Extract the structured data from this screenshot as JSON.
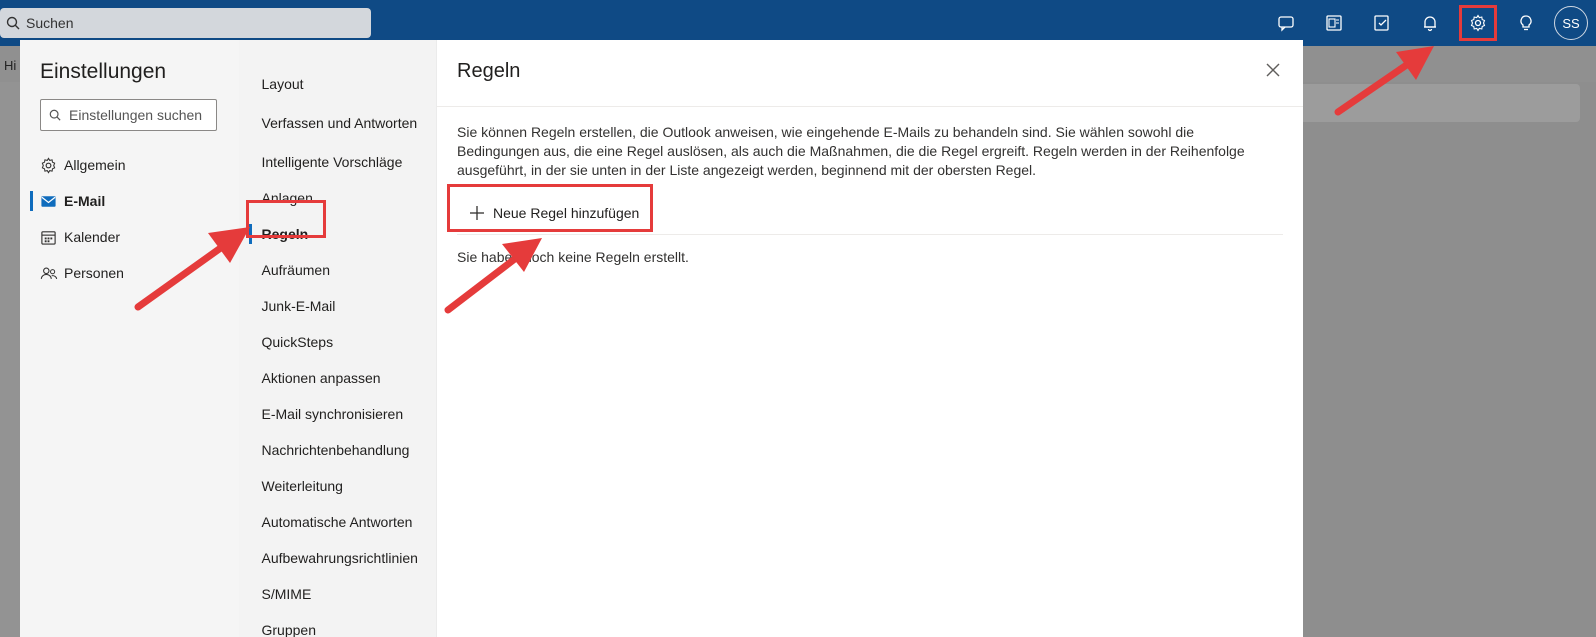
{
  "topbar": {
    "search_placeholder": "Suchen",
    "avatar_initials": "SS",
    "icons": [
      "teams-chat-icon",
      "outlook-notes-icon",
      "todo-icon",
      "bell-icon",
      "gear-icon",
      "lightbulb-icon"
    ],
    "background_color": "#0f4a85"
  },
  "background": {
    "ribbon_label": "Hi"
  },
  "settings": {
    "title": "Einstellungen",
    "search_placeholder": "Einstellungen suchen",
    "nav": [
      {
        "label": "Allgemein",
        "icon": "gear-icon"
      },
      {
        "label": "E-Mail",
        "icon": "mail-icon",
        "active": true
      },
      {
        "label": "Kalender",
        "icon": "calendar-icon"
      },
      {
        "label": "Personen",
        "icon": "people-icon"
      }
    ]
  },
  "mail_settings": {
    "items": [
      "Layout",
      "Verfassen und Antworten",
      "Intelligente Vorschläge",
      "Anlagen",
      "Regeln",
      "Aufräumen",
      "Junk-E-Mail",
      "QuickSteps",
      "Aktionen anpassen",
      "E-Mail synchronisieren",
      "Nachrichtenbehandlung",
      "Weiterleitung",
      "Automatische Antworten",
      "Aufbewahrungsrichtlinien",
      "S/MIME",
      "Gruppen"
    ],
    "active": "Regeln"
  },
  "rules_pane": {
    "title": "Regeln",
    "description": "Sie können Regeln erstellen, die Outlook anweisen, wie eingehende E-Mails zu behandeln sind. Sie wählen sowohl die Bedingungen aus, die eine Regel auslösen, als auch die Maßnahmen, die die Regel ergreift. Regeln werden in der Reihenfolge ausgeführt, in der sie unten in der Liste angezeigt werden, beginnend mit der obersten Regel.",
    "add_button": "Neue Regel hinzufügen",
    "empty_text": "Sie haben noch keine Regeln erstellt."
  },
  "colors": {
    "accent": "#0f6cbd",
    "highlight": "#e53b3b"
  }
}
